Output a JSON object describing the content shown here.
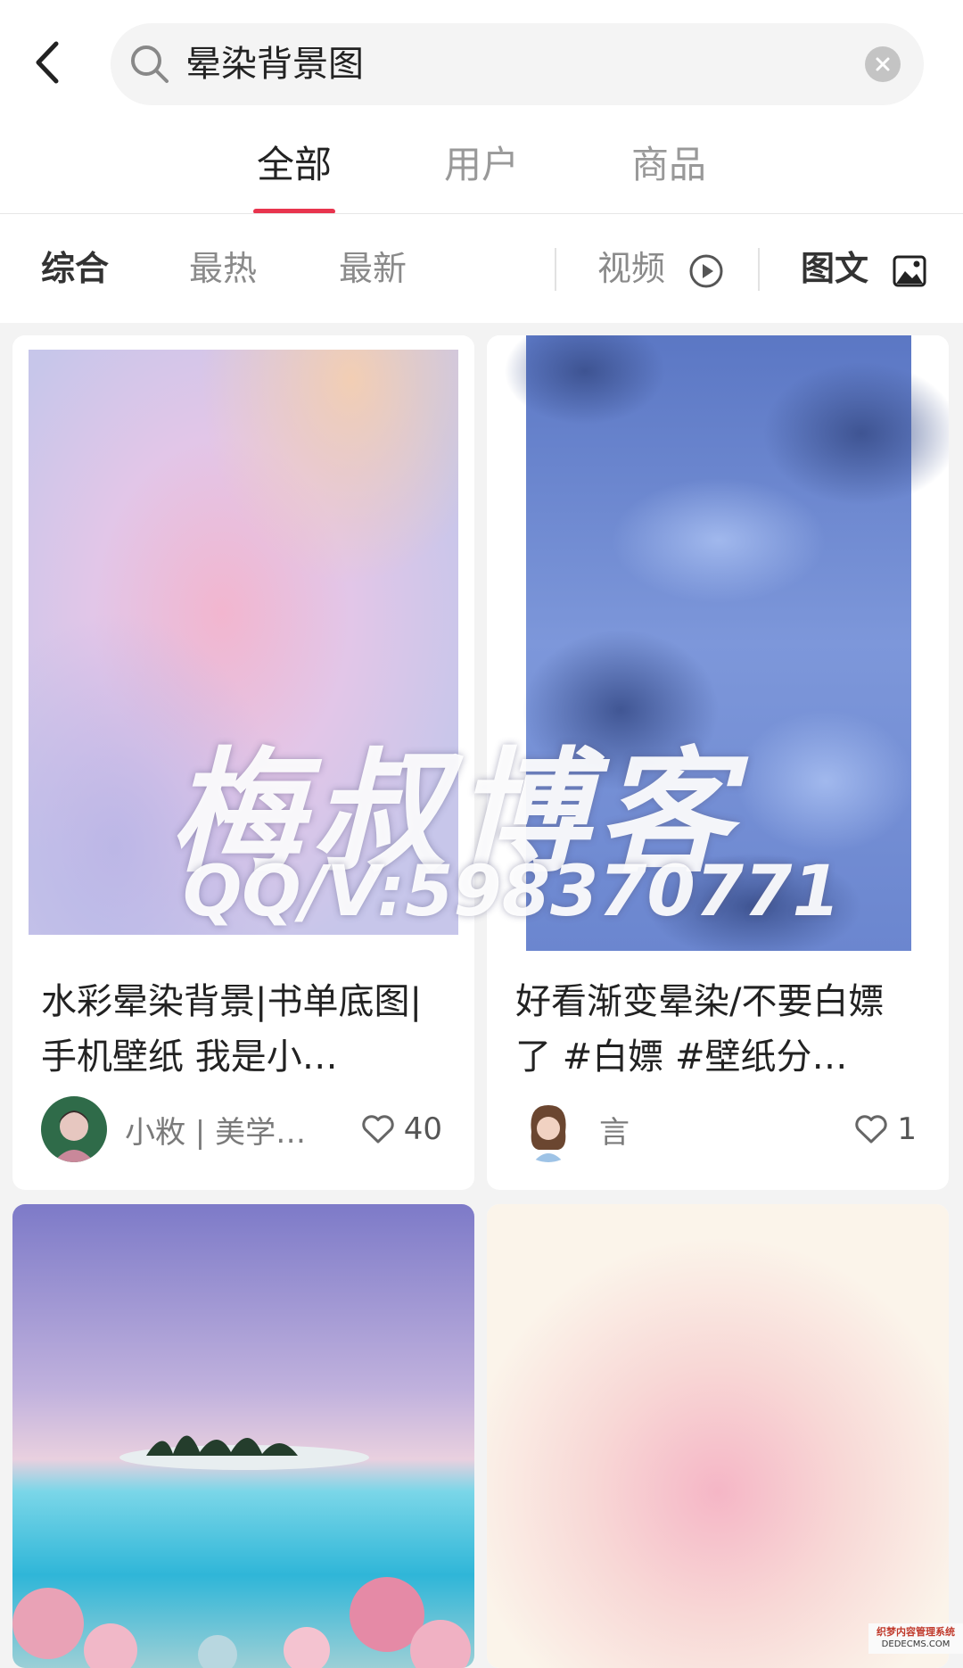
{
  "search": {
    "query": "晕染背景图"
  },
  "tabs": [
    {
      "label": "全部"
    },
    {
      "label": "用户"
    },
    {
      "label": "商品"
    }
  ],
  "filters": {
    "comprehensive": "综合",
    "hottest": "最热",
    "newest": "最新",
    "video": "视频",
    "image_text": "图文"
  },
  "cards": [
    {
      "title": "水彩晕染背景|书单底图|手机壁纸 我是小…",
      "author": "小敉 | 美学…",
      "likes": "40"
    },
    {
      "title": "好看渐变晕染/不要白嫖了 #白嫖  #壁纸分…",
      "author": "言",
      "likes": "1"
    },
    {
      "title": "",
      "author": "",
      "likes": ""
    },
    {
      "title": "",
      "author": "",
      "likes": ""
    }
  ],
  "watermark": {
    "main": "梅叔博客",
    "sub": "QQ/V:598370771",
    "corner_line1": "织梦内容管理系统",
    "corner_line2": "DEDECMS.COM"
  },
  "colors": {
    "accent": "#e8344e",
    "background": "#f3f3f3"
  }
}
